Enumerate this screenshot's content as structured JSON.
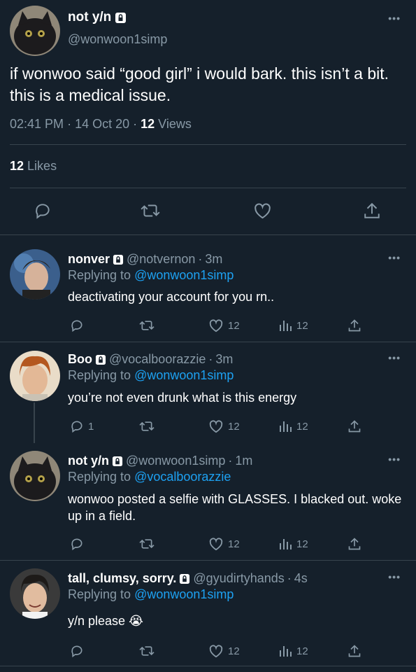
{
  "main": {
    "name": "not y/n",
    "handle": "@wonwoon1simp",
    "text": "if wonwoo said “good girl” i would bark. this isn’t a bit. this is a medical issue.",
    "time": "02:41 PM",
    "date": "14 Oct 20",
    "views_count": "12",
    "views_label": "Views",
    "likes_count": "12",
    "likes_label": "Likes"
  },
  "replies": [
    {
      "name": "nonver",
      "handle": "@notvernon",
      "time": "3m",
      "replying_label": "Replying to",
      "replying_to": "@wonwoon1simp",
      "text": "deactivating your account for you rn..",
      "reply_count": "",
      "like_count": "12",
      "view_count": "12"
    },
    {
      "name": "Boo",
      "handle": "@vocalboorazzie",
      "time": "3m",
      "replying_label": "Replying to",
      "replying_to": "@wonwoon1simp",
      "text": "you’re not even drunk what is this energy",
      "reply_count": "1",
      "like_count": "12",
      "view_count": "12"
    },
    {
      "name": "not y/n",
      "handle": "@wonwoon1simp",
      "time": "1m",
      "replying_label": "Replying to",
      "replying_to": "@vocalboorazzie",
      "text": "wonwoo posted a selfie with GLASSES. I blacked out. woke up in a field.",
      "reply_count": "",
      "like_count": "12",
      "view_count": "12"
    },
    {
      "name": "tall, clumsy, sorry.",
      "handle": "@gyudirtyhands",
      "time": "4s",
      "replying_label": "Replying to",
      "replying_to": "@wonwoon1simp",
      "text": "y/n please 😭",
      "reply_count": "",
      "like_count": "12",
      "view_count": "12"
    }
  ],
  "icons": {
    "more": "•••",
    "lock": "lock-icon",
    "reply": "reply-icon",
    "retweet": "retweet-icon",
    "like": "heart-icon",
    "views": "views-icon",
    "share": "share-icon"
  },
  "colors": {
    "background": "#15202b",
    "muted": "#8899a6",
    "link": "#1da1f2",
    "divider": "#38444d"
  }
}
